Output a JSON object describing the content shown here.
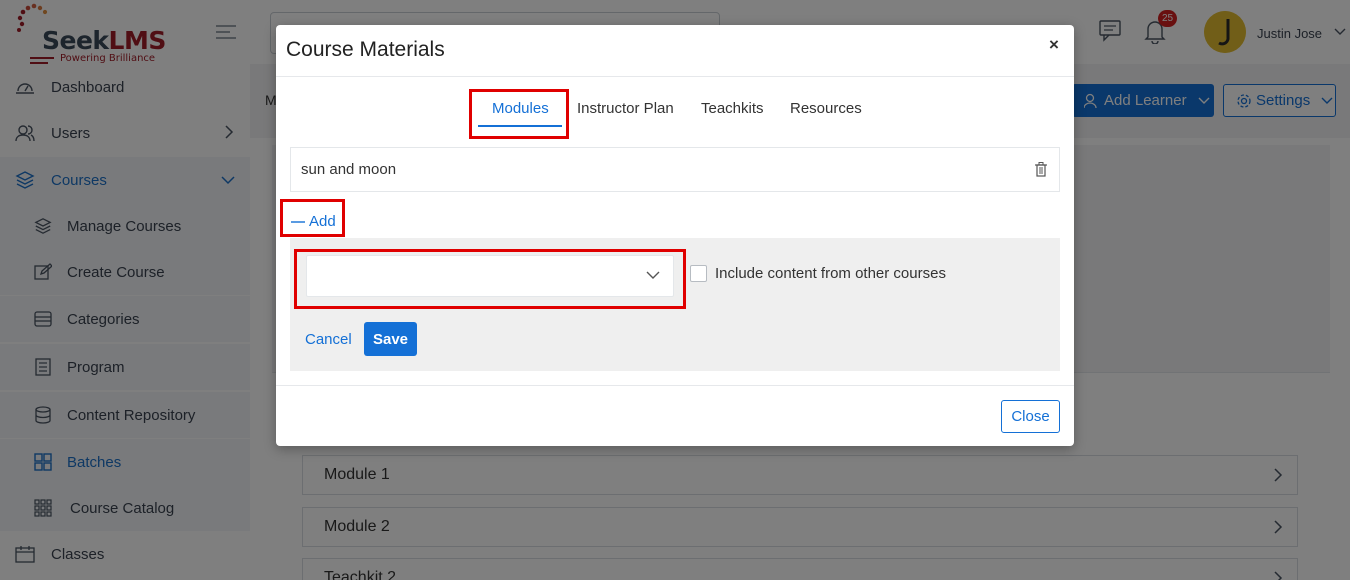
{
  "app": {
    "logo": {
      "name_part1": "Seek",
      "name_part2": "LMS",
      "tagline": "Powering Brilliance"
    },
    "user": {
      "name": "Justin Jose"
    },
    "notifications": {
      "count": "25"
    },
    "breadcrumb_initial": "M"
  },
  "sidebar": {
    "items": [
      {
        "label": "Dashboard",
        "icon": "cloud-gauge-icon"
      },
      {
        "label": "Users",
        "icon": "users-icon"
      },
      {
        "label": "Courses",
        "icon": "layers-icon"
      },
      {
        "label": "Manage Courses",
        "icon": "layers-icon"
      },
      {
        "label": "Create Course",
        "icon": "edit-icon"
      },
      {
        "label": "Categories",
        "icon": "categories-icon"
      },
      {
        "label": "Program",
        "icon": "program-icon"
      },
      {
        "label": "Content Repository",
        "icon": "database-icon"
      },
      {
        "label": "Batches",
        "icon": "grid-icon"
      },
      {
        "label": "Course Catalog",
        "icon": "catalog-grid-icon"
      },
      {
        "label": "Classes",
        "icon": "calendar-icon"
      }
    ]
  },
  "header": {
    "add_learner_label": "Add Learner",
    "settings_label": "Settings"
  },
  "background_modules": [
    "Module 1",
    "Module 2",
    "Teachkit 2"
  ],
  "modal": {
    "title": "Course Materials",
    "close_symbol": "×",
    "tabs": [
      "Modules",
      "Instructor Plan",
      "Teachkits",
      "Resources"
    ],
    "active_tab": "Modules",
    "materials": [
      "sun and moon"
    ],
    "add_label": "Add",
    "select_value": "",
    "include_other_label": "Include content from other courses",
    "include_other_checked": false,
    "cancel_label": "Cancel",
    "save_label": "Save",
    "close_label": "Close"
  },
  "colors": {
    "primary": "#1470d6",
    "highlight": "#e00000",
    "brand_red": "#a11d28"
  }
}
